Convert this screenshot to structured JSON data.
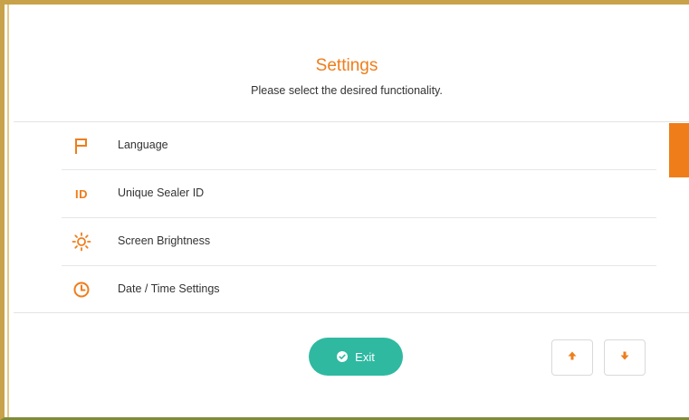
{
  "header": {
    "title": "Settings",
    "subtitle": "Please select the desired functionality."
  },
  "menu": {
    "items": [
      {
        "label": "Language",
        "icon": "flag-icon"
      },
      {
        "label": "Unique Sealer ID",
        "icon": "id-icon",
        "icon_text": "ID"
      },
      {
        "label": "Screen Brightness",
        "icon": "sun-icon"
      },
      {
        "label": "Date / Time Settings",
        "icon": "clock-icon"
      }
    ]
  },
  "footer": {
    "exit_label": "Exit",
    "scroll_up_icon": "arrow-up-icon",
    "scroll_down_icon": "arrow-down-icon"
  },
  "colors": {
    "accent": "#ef7d1a",
    "exit_button": "#2fb9a1",
    "frame_border": "#c8a24a"
  }
}
